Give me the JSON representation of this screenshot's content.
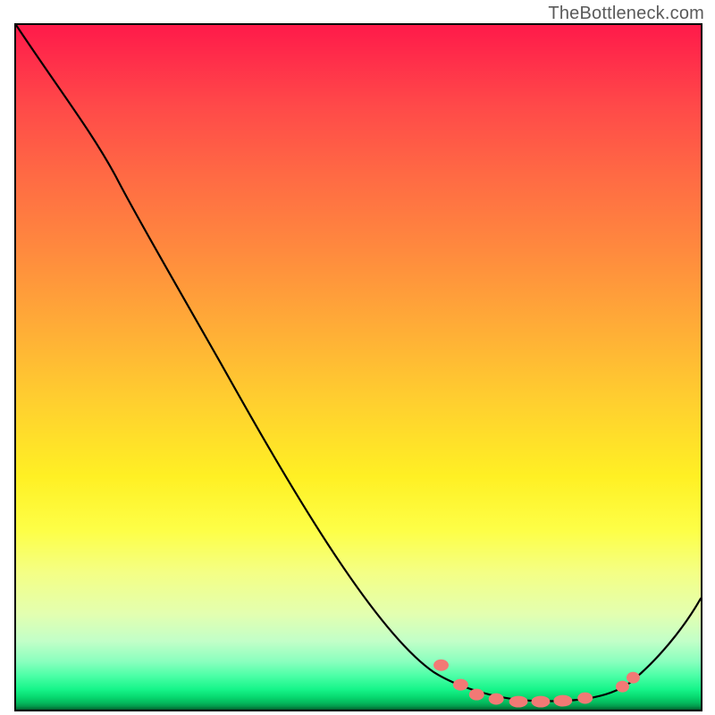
{
  "attribution": "TheBottleneck.com",
  "chart_data": {
    "type": "line",
    "title": "",
    "xlabel": "",
    "ylabel": "",
    "xlim": [
      0,
      100
    ],
    "ylim": [
      0,
      100
    ],
    "series": [
      {
        "name": "bottleneck-curve",
        "x": [
          0,
          6,
          12,
          15,
          20,
          30,
          40,
          52,
          61,
          70,
          76,
          82,
          88,
          93,
          100
        ],
        "y": [
          100,
          92,
          82,
          78,
          70,
          51,
          34,
          18,
          6,
          2,
          1.2,
          1.3,
          2.5,
          5,
          16
        ]
      }
    ],
    "markers": {
      "name": "basin-points",
      "color": "#f27975",
      "x": [
        62,
        65,
        67,
        70,
        73,
        77,
        80,
        83,
        89,
        90
      ],
      "y": [
        6.5,
        3.6,
        2.2,
        1.6,
        1.2,
        1.2,
        1.3,
        1.7,
        3.4,
        4.7
      ]
    },
    "background": {
      "type": "vertical-gradient",
      "top_color": "#ff1a4a",
      "bottom_color": "#015c2d",
      "intent": "red (high bottleneck) → green (no bottleneck)"
    }
  },
  "colors": {
    "border": "#000000",
    "curve": "#000000",
    "marker": "#f27975",
    "attribution": "#5a5a5a"
  }
}
